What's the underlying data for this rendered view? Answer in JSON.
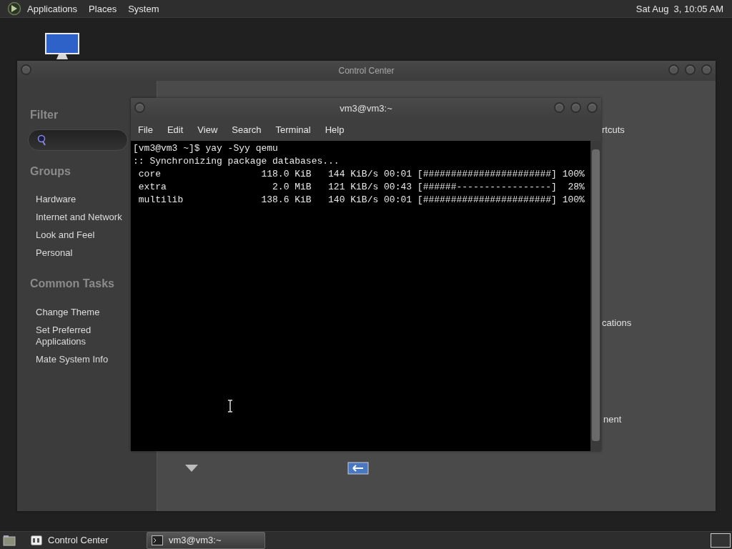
{
  "top_panel": {
    "menus": [
      "Applications",
      "Places",
      "System"
    ],
    "clock": "Sat Aug  3, 10:05 AM"
  },
  "control_center": {
    "title": "Control Center",
    "sidebar": {
      "filter_heading": "Filter",
      "groups_heading": "Groups",
      "groups": [
        "Hardware",
        "Internet and Network",
        "Look and Feel",
        "Personal"
      ],
      "tasks_heading": "Common Tasks",
      "tasks": [
        "Change Theme",
        "Set Preferred Applications",
        "Mate System Info"
      ]
    },
    "content": {
      "partial_items": [
        "rtcuts",
        "cations",
        "nent"
      ]
    }
  },
  "terminal": {
    "title": "vm3@vm3:~",
    "menu": [
      "File",
      "Edit",
      "View",
      "Search",
      "Terminal",
      "Help"
    ],
    "lines": [
      "[vm3@vm3 ~]$ yay -Syy qemu",
      ":: Synchronizing package databases...",
      " core                  118.0 KiB   144 KiB/s 00:01 [#######################] 100%",
      " extra                   2.0 MiB   121 KiB/s 00:43 [######-----------------]  28%",
      " multilib              138.6 KiB   140 KiB/s 00:01 [#######################] 100%"
    ]
  },
  "taskbar": {
    "items": [
      {
        "label": "Control Center",
        "selected": false
      },
      {
        "label": "vm3@vm3:~",
        "selected": true
      }
    ]
  }
}
